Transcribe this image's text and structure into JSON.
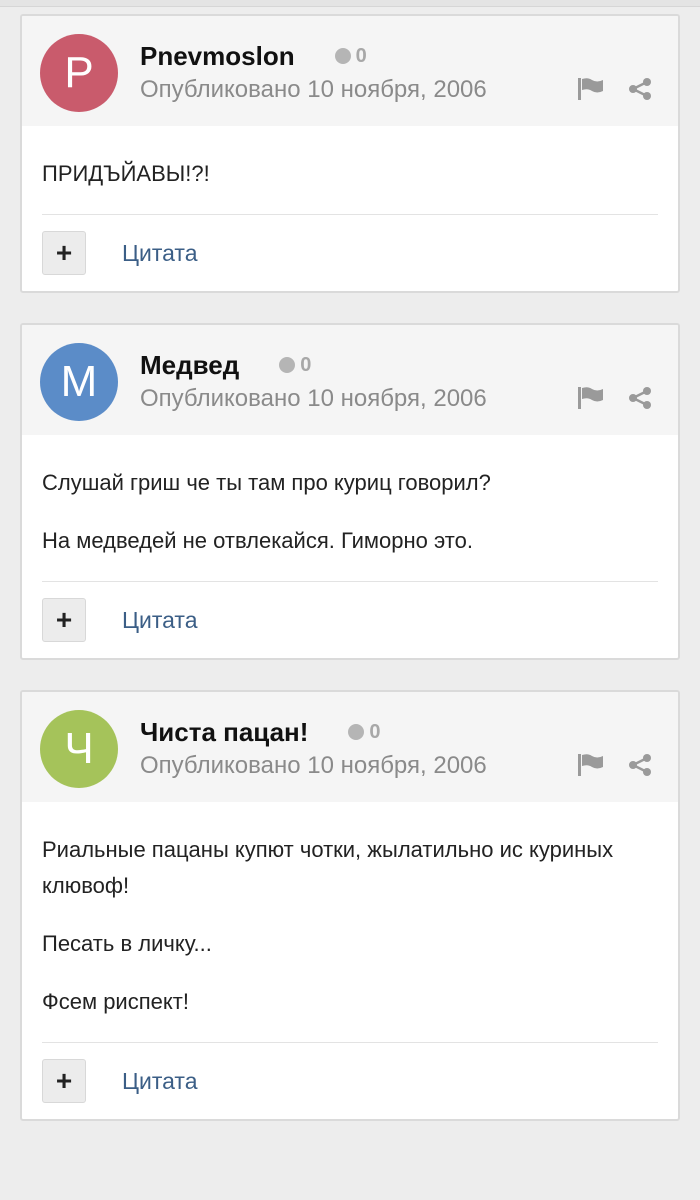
{
  "posts": [
    {
      "avatar_letter": "P",
      "avatar_color": "#c95b6c",
      "author": "Pnevmoslon",
      "reputation": "0",
      "date": "Опубликовано 10 ноября, 2006",
      "paragraphs": [
        "ПРИДЪЙАВЫ!?!"
      ],
      "quote_label": "Цитата"
    },
    {
      "avatar_letter": "М",
      "avatar_color": "#5b8cc8",
      "author": "Медвед",
      "reputation": "0",
      "date": "Опубликовано 10 ноября, 2006",
      "paragraphs": [
        "Слушай гриш че ты там про куриц говорил?",
        "На медведей не отвлекайся. Гиморно это."
      ],
      "quote_label": "Цитата"
    },
    {
      "avatar_letter": "Ч",
      "avatar_color": "#a5c35a",
      "author": "Чиста пацан!",
      "reputation": "0",
      "date": "Опубликовано 10 ноября, 2006",
      "paragraphs": [
        "Риальные пацаны купют чотки, жылатильно ис куриных клювоф!",
        "Песать в личку...",
        "Фсем риспект!"
      ],
      "quote_label": "Цитата"
    }
  ],
  "icons": {
    "flag": "flag-icon",
    "share": "share-icon",
    "plus": "+"
  }
}
